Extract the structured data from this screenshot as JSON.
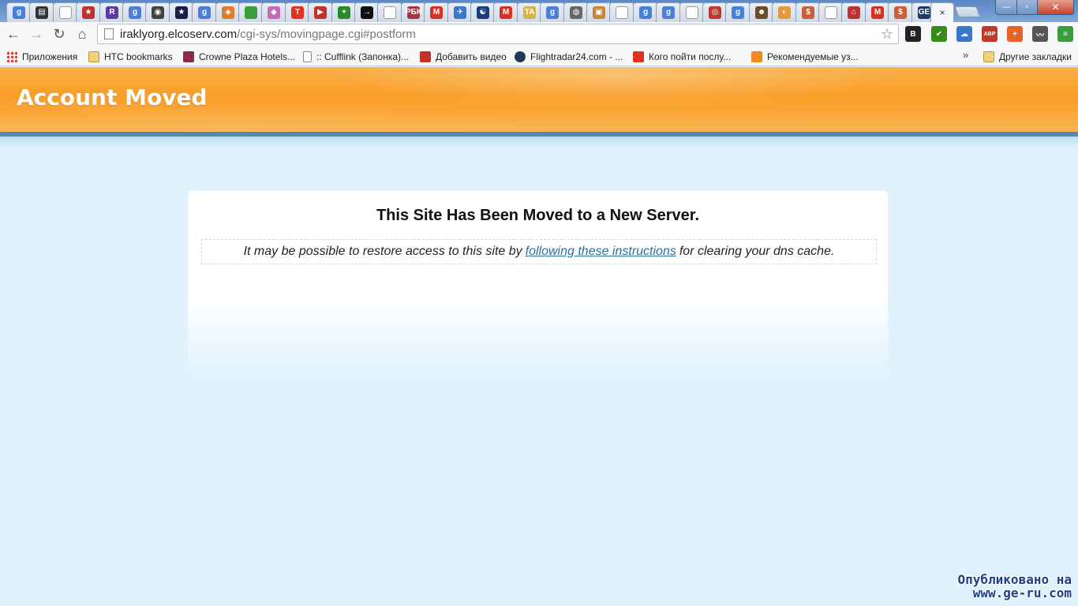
{
  "browser": {
    "tabs": [
      {
        "icon": "google-icon",
        "glyph": "g",
        "color": "#4a7fd8"
      },
      {
        "icon": "hdd-icon",
        "glyph": "▤",
        "color": "#333"
      },
      {
        "icon": "page-icon",
        "glyph": "",
        "color": "#fff"
      },
      {
        "icon": "star-badge-icon",
        "glyph": "★",
        "color": "#b33"
      },
      {
        "icon": "r-letter-icon",
        "glyph": "R",
        "color": "#5b3d9e"
      },
      {
        "icon": "google-icon",
        "glyph": "g",
        "color": "#4a7fd8"
      },
      {
        "icon": "film-reel-icon",
        "glyph": "◉",
        "color": "#444"
      },
      {
        "icon": "gold-star-icon",
        "glyph": "★",
        "color": "#1a1a4a"
      },
      {
        "icon": "google-icon",
        "glyph": "g",
        "color": "#4a7fd8"
      },
      {
        "icon": "lifebuoy-icon",
        "glyph": "◈",
        "color": "#e07a2c"
      },
      {
        "icon": "italy-flag-icon",
        "glyph": "",
        "color": "#3a9d3a"
      },
      {
        "icon": "gamepad-icon",
        "glyph": "◆",
        "color": "#c56bb5"
      },
      {
        "icon": "t-letter-icon",
        "glyph": "T",
        "color": "#e0321e"
      },
      {
        "icon": "youtube-icon",
        "glyph": "▶",
        "color": "#c4302b"
      },
      {
        "icon": "plus-cross-icon",
        "glyph": "+",
        "color": "#2a8a2a"
      },
      {
        "icon": "arrow-right-icon",
        "glyph": "→",
        "color": "#111"
      },
      {
        "icon": "page-icon",
        "glyph": "",
        "color": "#fff"
      },
      {
        "icon": "rbc-icon",
        "glyph": "РБК",
        "color": "#a63248"
      },
      {
        "icon": "gmail-icon",
        "glyph": "M",
        "color": "#d93025"
      },
      {
        "icon": "plane-icon",
        "glyph": "✈",
        "color": "#3a77c6"
      },
      {
        "icon": "yin-yang-icon",
        "glyph": "☯",
        "color": "#1a3b7a"
      },
      {
        "icon": "gmail-icon",
        "glyph": "M",
        "color": "#d93025"
      },
      {
        "icon": "ta-icon",
        "glyph": "TA",
        "color": "#d3b44a"
      },
      {
        "icon": "google-icon",
        "glyph": "g",
        "color": "#4a7fd8"
      },
      {
        "icon": "globe-icon",
        "glyph": "◍",
        "color": "#666"
      },
      {
        "icon": "photo-icon",
        "glyph": "▣",
        "color": "#c9843c"
      },
      {
        "icon": "page-icon",
        "glyph": "",
        "color": "#fff"
      },
      {
        "icon": "google-icon",
        "glyph": "g",
        "color": "#4a7fd8"
      },
      {
        "icon": "google-icon",
        "glyph": "g",
        "color": "#4a7fd8"
      },
      {
        "icon": "page-icon",
        "glyph": "",
        "color": "#fff"
      },
      {
        "icon": "record-icon",
        "glyph": "◎",
        "color": "#c0392b"
      },
      {
        "icon": "google-icon",
        "glyph": "g",
        "color": "#4a7fd8"
      },
      {
        "icon": "person-photo-icon",
        "glyph": "☻",
        "color": "#6b4b2a"
      },
      {
        "icon": "swirl-icon",
        "glyph": "◐",
        "color": "#e59a3a"
      },
      {
        "icon": "dollar-sign-icon",
        "glyph": "$",
        "color": "#c9603c"
      },
      {
        "icon": "page-icon",
        "glyph": "",
        "color": "#fff"
      },
      {
        "icon": "house-icon",
        "glyph": "⌂",
        "color": "#b33"
      },
      {
        "icon": "gmail-icon",
        "glyph": "M",
        "color": "#d93025"
      },
      {
        "icon": "dollar-sign-icon",
        "glyph": "$",
        "color": "#c9603c"
      },
      {
        "icon": "geru-icon",
        "glyph": "GE",
        "color": "#1e3a66"
      }
    ],
    "active_tab_close": "×",
    "window_controls": {
      "minimize": "—",
      "maximize": "▫",
      "close": "✕"
    },
    "url_host": "iraklyorg.elcoserv.com",
    "url_path": "/cgi-sys/movingpage.cgi#postform",
    "extensions": [
      {
        "icon": "b-letter-icon",
        "glyph": "B",
        "color": "#222"
      },
      {
        "icon": "check-badge-icon",
        "glyph": "✔",
        "color": "#3a8a1a"
      },
      {
        "icon": "cloud-icon",
        "glyph": "☁",
        "color": "#3a77c6"
      },
      {
        "icon": "adblock-icon",
        "glyph": "ABP",
        "color": "#c0392b"
      },
      {
        "icon": "plus-square-icon",
        "glyph": "+",
        "color": "#e8622a"
      },
      {
        "icon": "chart-line-icon",
        "glyph": "〰",
        "color": "#555"
      },
      {
        "icon": "menu-icon",
        "glyph": "≡",
        "color": "#3a9d3a"
      }
    ],
    "bookmarks": [
      {
        "label": "Приложения",
        "icon": "apps-icon"
      },
      {
        "label": "HTC bookmarks",
        "icon": "folder-icon"
      },
      {
        "label": "Crowne Plaza Hotels...",
        "icon": "crowne-plaza-icon"
      },
      {
        "label": ":: Cufflink (Запонка)...",
        "icon": "doc-icon"
      },
      {
        "label": "Добавить видео",
        "icon": "youtube-icon"
      },
      {
        "label": "Flightradar24.com - ...",
        "icon": "flightradar-icon"
      },
      {
        "label": "Кого пойти послу...",
        "icon": "s-letter-icon"
      },
      {
        "label": "Рекомендуемые уз...",
        "icon": "bulb-icon"
      }
    ],
    "bookmarks_more": "»",
    "other_bookmarks": "Другие закладки"
  },
  "page": {
    "banner_title": "Account Moved",
    "heading": "This Site Has Been Moved to a New Server.",
    "notice_before": "It may be possible to restore access to this site by",
    "notice_link": "following these instructions",
    "notice_after": "for clearing your dns cache."
  },
  "watermark": {
    "line1": "Опубликовано на",
    "line2": "www.ge-ru.com"
  }
}
